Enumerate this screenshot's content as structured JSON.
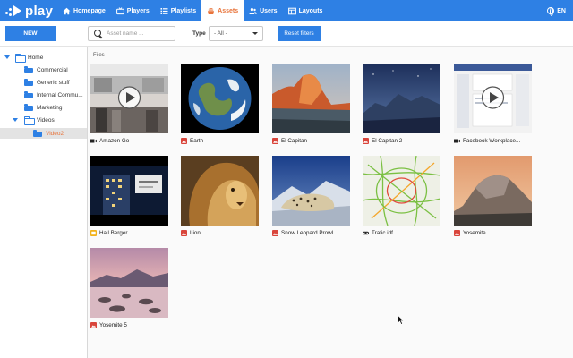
{
  "brand": {
    "name": "play"
  },
  "nav": [
    {
      "label": "Homepage",
      "icon": "home-icon",
      "active": false
    },
    {
      "label": "Players",
      "icon": "tv-icon",
      "active": false
    },
    {
      "label": "Playlists",
      "icon": "list-icon",
      "active": false
    },
    {
      "label": "Assets",
      "icon": "layers-icon",
      "active": true
    },
    {
      "label": "Users",
      "icon": "users-icon",
      "active": false
    },
    {
      "label": "Layouts",
      "icon": "layout-icon",
      "active": false
    }
  ],
  "language": "EN",
  "toolbar": {
    "new_label": "NEW",
    "search_placeholder": "Asset name ...",
    "type_label": "Type",
    "type_value": "- All -",
    "reset_label": "Reset filters"
  },
  "tree": [
    {
      "label": "Home",
      "depth": 0,
      "expanded": true,
      "selected": false
    },
    {
      "label": "Commercial",
      "depth": 1,
      "expanded": false,
      "selected": false
    },
    {
      "label": "Generic stuff",
      "depth": 1,
      "expanded": false,
      "selected": false
    },
    {
      "label": "Internal Commu...",
      "depth": 1,
      "expanded": false,
      "selected": false
    },
    {
      "label": "Marketing",
      "depth": 1,
      "expanded": false,
      "selected": false
    },
    {
      "label": "Videos",
      "depth": 1,
      "expanded": true,
      "selected": false
    },
    {
      "label": "Video2",
      "depth": 2,
      "expanded": false,
      "selected": true
    }
  ],
  "files_label": "Files",
  "assets": [
    {
      "name": "Amazon Go",
      "type": "video"
    },
    {
      "name": "Earth",
      "type": "image"
    },
    {
      "name": "El Capitan",
      "type": "image"
    },
    {
      "name": "El Capitan 2",
      "type": "image"
    },
    {
      "name": "Facebook Workplace...",
      "type": "video"
    },
    {
      "name": "Hall Berger",
      "type": "slides"
    },
    {
      "name": "Lion",
      "type": "image"
    },
    {
      "name": "Snow Leopard Prowl",
      "type": "image"
    },
    {
      "name": "Trafic idf",
      "type": "link"
    },
    {
      "name": "Yosemite",
      "type": "image"
    },
    {
      "name": "Yosemite 5",
      "type": "image"
    }
  ],
  "colors": {
    "primary": "#2e80e4",
    "active_accent": "#e8743b",
    "image_badge": "#d9453b",
    "slides_badge": "#f2b21b"
  }
}
